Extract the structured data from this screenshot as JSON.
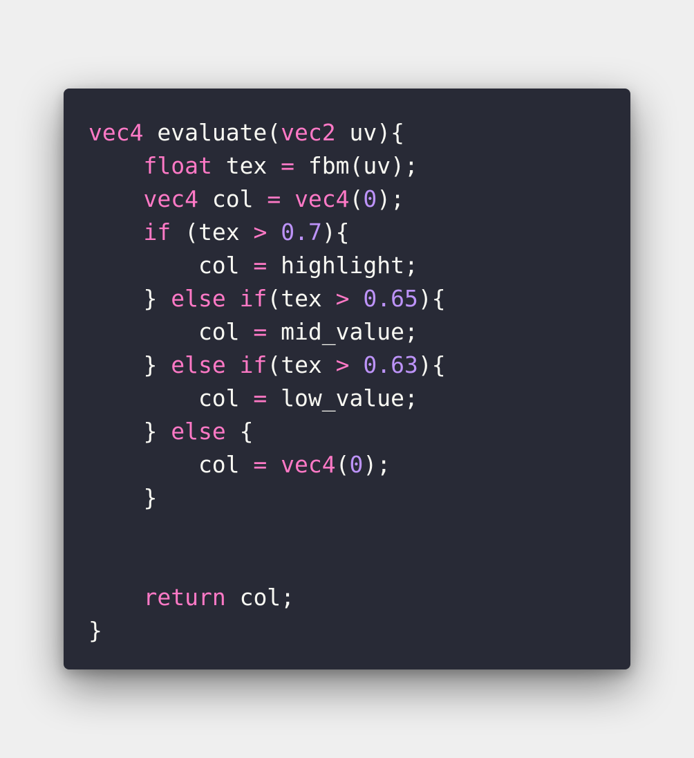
{
  "colors": {
    "background": "#efefef",
    "card": "#282a36",
    "text": "#f8f8f2",
    "keyword": "#ff79c6",
    "number": "#bd93f9"
  },
  "code_lines": [
    [
      {
        "k": "kw",
        "t": "vec4"
      },
      {
        "k": "text",
        "t": " evaluate("
      },
      {
        "k": "kw",
        "t": "vec2"
      },
      {
        "k": "text",
        "t": " uv){"
      }
    ],
    [
      {
        "k": "text",
        "t": "    "
      },
      {
        "k": "kw",
        "t": "float"
      },
      {
        "k": "text",
        "t": " tex "
      },
      {
        "k": "kw",
        "t": "="
      },
      {
        "k": "text",
        "t": " fbm(uv);"
      }
    ],
    [
      {
        "k": "text",
        "t": "    "
      },
      {
        "k": "kw",
        "t": "vec4"
      },
      {
        "k": "text",
        "t": " col "
      },
      {
        "k": "kw",
        "t": "="
      },
      {
        "k": "text",
        "t": " "
      },
      {
        "k": "kw",
        "t": "vec4"
      },
      {
        "k": "text",
        "t": "("
      },
      {
        "k": "num",
        "t": "0"
      },
      {
        "k": "text",
        "t": ");"
      }
    ],
    [
      {
        "k": "text",
        "t": "    "
      },
      {
        "k": "kw",
        "t": "if"
      },
      {
        "k": "text",
        "t": " (tex "
      },
      {
        "k": "kw",
        "t": ">"
      },
      {
        "k": "text",
        "t": " "
      },
      {
        "k": "num",
        "t": "0.7"
      },
      {
        "k": "text",
        "t": "){"
      }
    ],
    [
      {
        "k": "text",
        "t": "        col "
      },
      {
        "k": "kw",
        "t": "="
      },
      {
        "k": "text",
        "t": " highlight;"
      }
    ],
    [
      {
        "k": "text",
        "t": "    } "
      },
      {
        "k": "kw",
        "t": "else"
      },
      {
        "k": "text",
        "t": " "
      },
      {
        "k": "kw",
        "t": "if"
      },
      {
        "k": "text",
        "t": "(tex "
      },
      {
        "k": "kw",
        "t": ">"
      },
      {
        "k": "text",
        "t": " "
      },
      {
        "k": "num",
        "t": "0.65"
      },
      {
        "k": "text",
        "t": "){"
      }
    ],
    [
      {
        "k": "text",
        "t": "        col "
      },
      {
        "k": "kw",
        "t": "="
      },
      {
        "k": "text",
        "t": " mid_value;"
      }
    ],
    [
      {
        "k": "text",
        "t": "    } "
      },
      {
        "k": "kw",
        "t": "else"
      },
      {
        "k": "text",
        "t": " "
      },
      {
        "k": "kw",
        "t": "if"
      },
      {
        "k": "text",
        "t": "(tex "
      },
      {
        "k": "kw",
        "t": ">"
      },
      {
        "k": "text",
        "t": " "
      },
      {
        "k": "num",
        "t": "0.63"
      },
      {
        "k": "text",
        "t": "){"
      }
    ],
    [
      {
        "k": "text",
        "t": "        col "
      },
      {
        "k": "kw",
        "t": "="
      },
      {
        "k": "text",
        "t": " low_value;"
      }
    ],
    [
      {
        "k": "text",
        "t": "    } "
      },
      {
        "k": "kw",
        "t": "else"
      },
      {
        "k": "text",
        "t": " {"
      }
    ],
    [
      {
        "k": "text",
        "t": "        col "
      },
      {
        "k": "kw",
        "t": "="
      },
      {
        "k": "text",
        "t": " "
      },
      {
        "k": "kw",
        "t": "vec4"
      },
      {
        "k": "text",
        "t": "("
      },
      {
        "k": "num",
        "t": "0"
      },
      {
        "k": "text",
        "t": ");"
      }
    ],
    [
      {
        "k": "text",
        "t": "    }"
      }
    ],
    [],
    [],
    [
      {
        "k": "text",
        "t": "    "
      },
      {
        "k": "kw",
        "t": "return"
      },
      {
        "k": "text",
        "t": " col;"
      }
    ],
    [
      {
        "k": "text",
        "t": "}"
      }
    ]
  ]
}
